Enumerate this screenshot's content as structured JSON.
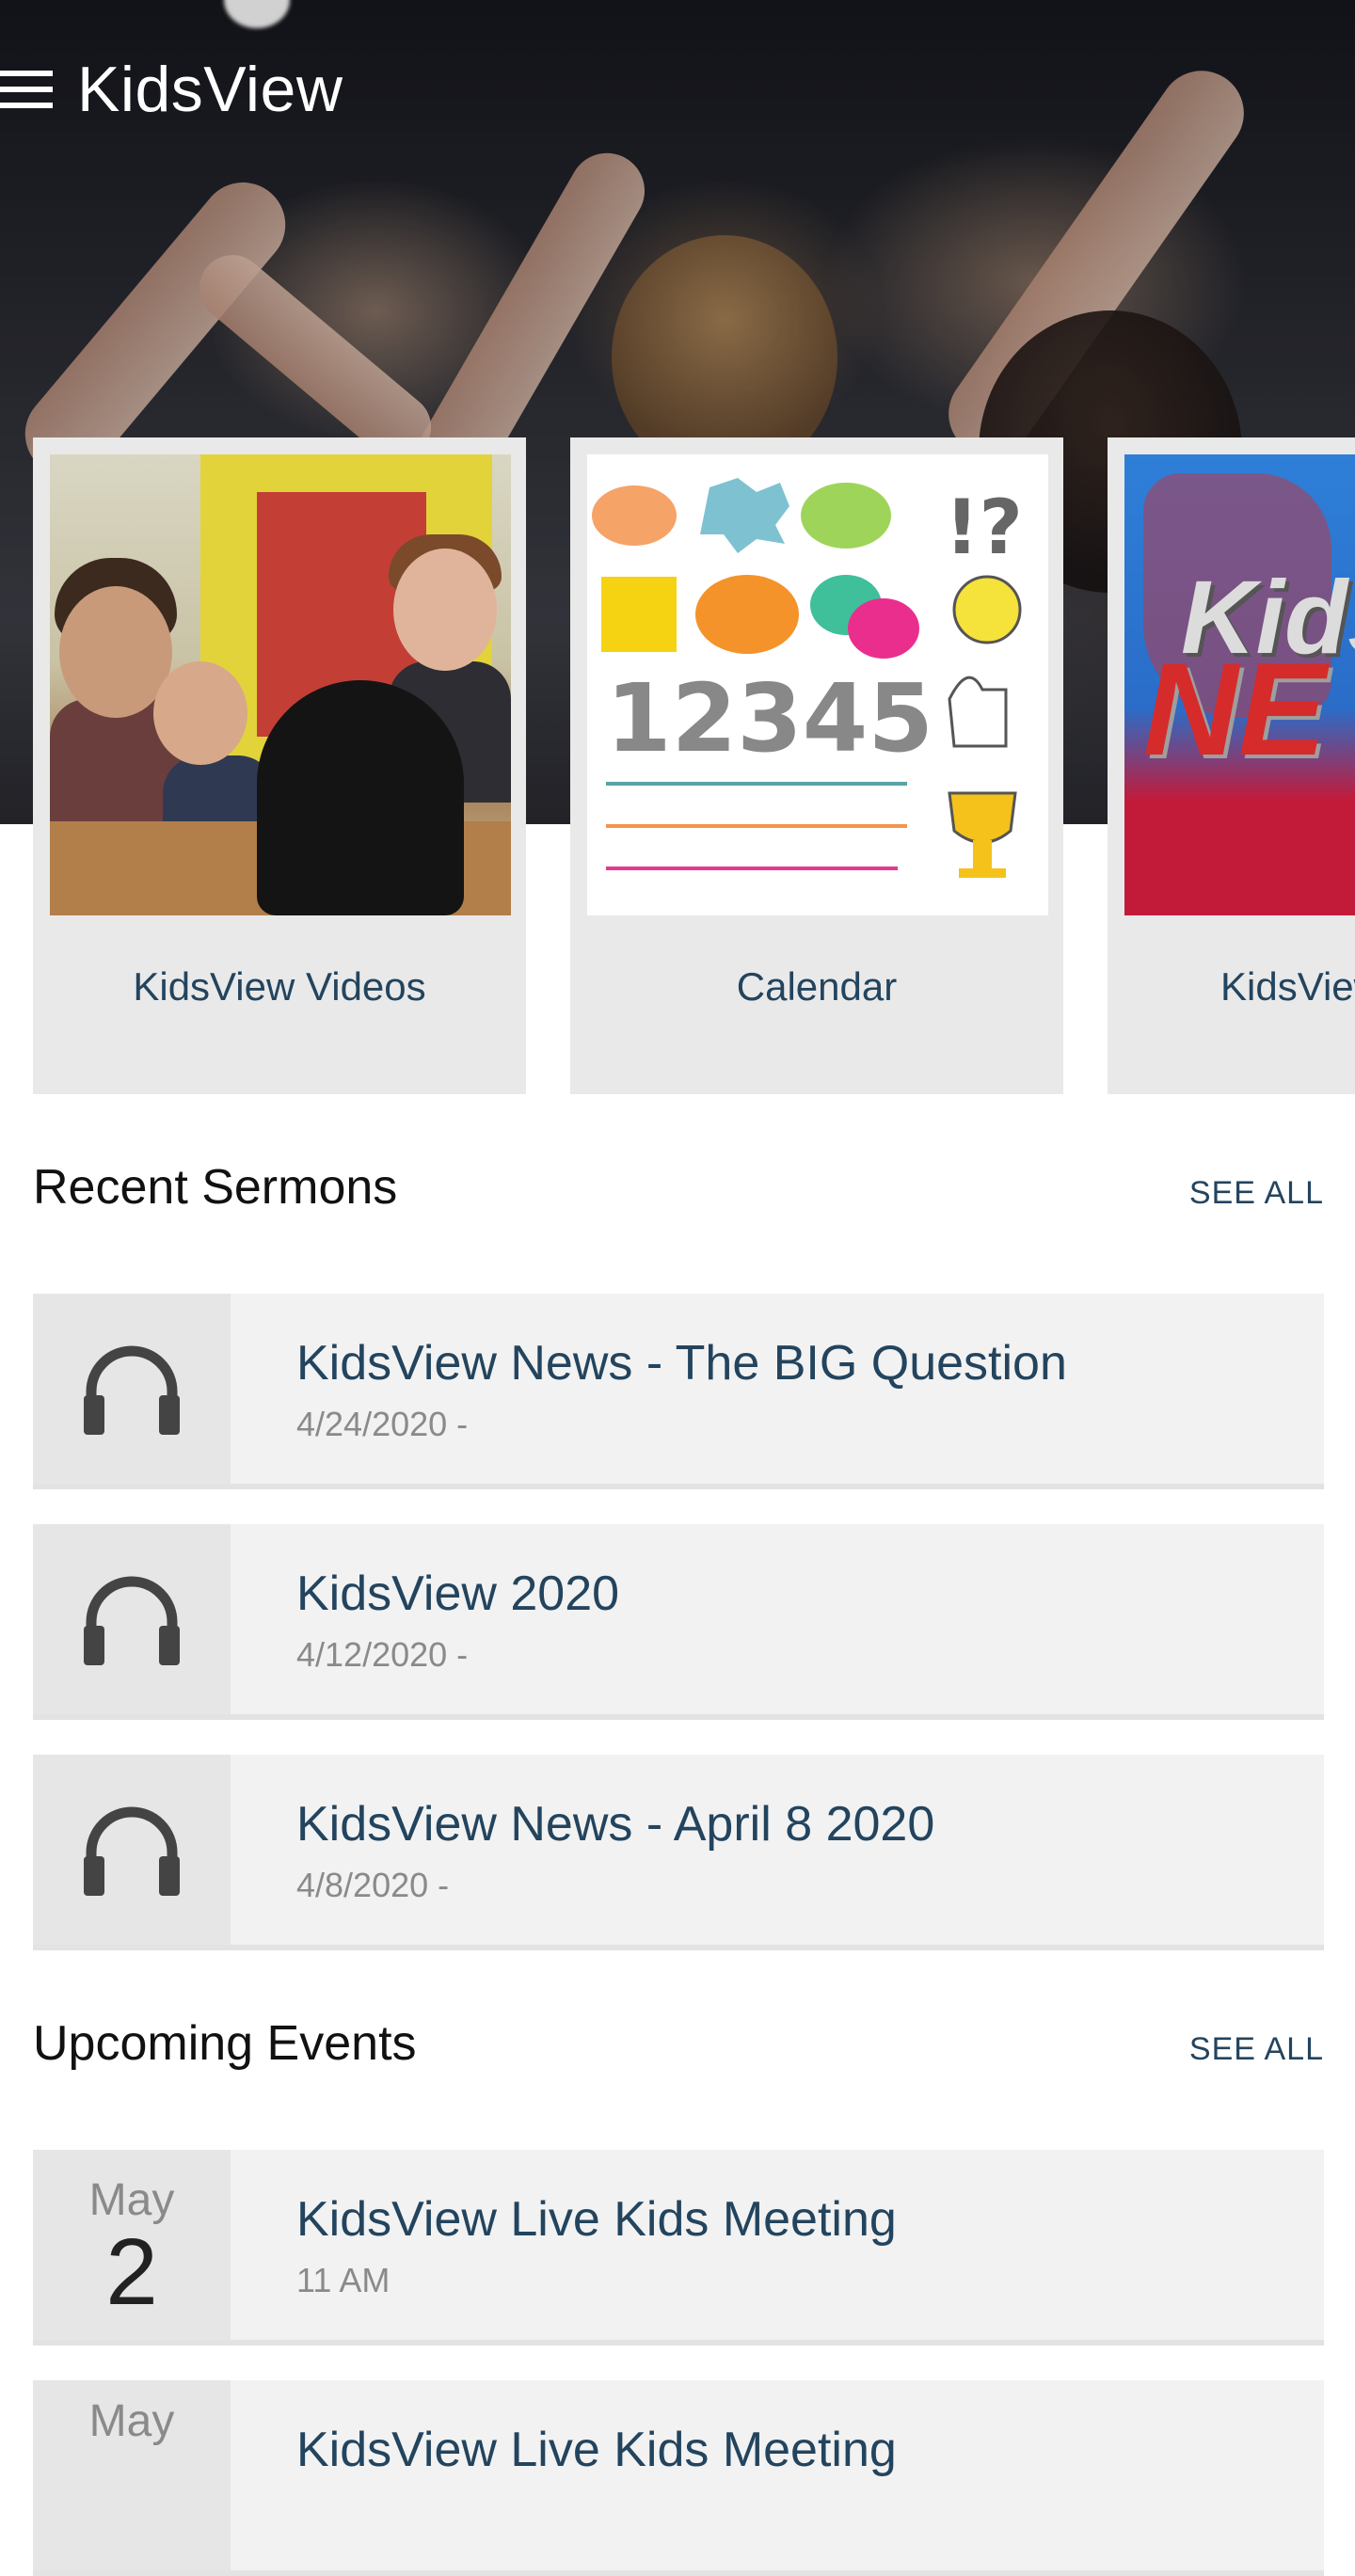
{
  "header": {
    "app_title": "KidsView",
    "menu_icon": "hamburger-menu-icon"
  },
  "cards": [
    {
      "label": "KidsView Videos",
      "image": "classroom-photo"
    },
    {
      "label": "Calendar",
      "image": "doodle-illustration"
    },
    {
      "label": "KidsView",
      "image": "kidsview-news-graphic",
      "image_text": [
        "Kids",
        "NE"
      ]
    }
  ],
  "sermons": {
    "title": "Recent Sermons",
    "see_all": "SEE ALL",
    "icon": "headphones-icon",
    "items": [
      {
        "title": "KidsView News - The BIG Question",
        "date": "4/24/2020 -"
      },
      {
        "title": "KidsView 2020",
        "date": "4/12/2020 -"
      },
      {
        "title": "KidsView News - April 8 2020",
        "date": "4/8/2020 -"
      }
    ]
  },
  "events": {
    "title": "Upcoming Events",
    "see_all": "SEE ALL",
    "items": [
      {
        "month": "May",
        "day": "2",
        "title": "KidsView Live Kids Meeting",
        "time": "11 AM"
      },
      {
        "month": "May",
        "day": "",
        "title": "KidsView Live Kids Meeting",
        "time": ""
      }
    ]
  },
  "colors": {
    "link_text": "#23445e",
    "card_background": "#e9e9e9",
    "list_background": "#f2f2f2",
    "icon_box_background": "#e6e6e6",
    "headphones": "#444444"
  }
}
